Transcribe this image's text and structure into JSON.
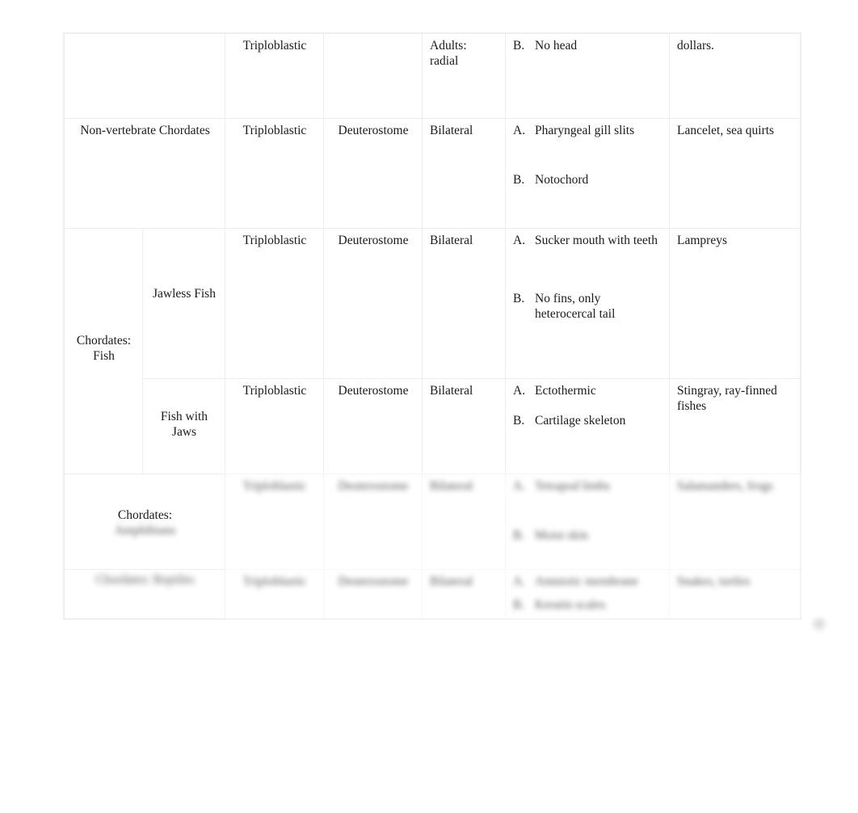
{
  "document": {
    "kind": "comparison-table",
    "columns": [
      "Group",
      "Subgroup",
      "Germ Layers",
      "Embryonic Development",
      "Symmetry",
      "Characteristics",
      "Examples"
    ]
  },
  "table": {
    "rows": [
      {
        "id": "row-echinoderms-partial",
        "group": "",
        "subgroup": "",
        "germ_layers": "Triploblastic",
        "development": "",
        "symmetry": "Adults:\nradial",
        "characteristics": [
          {
            "marker": "B.",
            "text": "No head"
          }
        ],
        "examples": "dollars."
      },
      {
        "id": "row-non-vertebrate-chordates",
        "group": "Non-vertebrate Chordates",
        "subgroup": "",
        "germ_layers": "Triploblastic",
        "development": "Deuterostome",
        "symmetry": "Bilateral",
        "characteristics": [
          {
            "marker": "A.",
            "text": "Pharyngeal gill slits"
          },
          {
            "marker": "B.",
            "text": "Notochord"
          }
        ],
        "examples": "Lancelet, sea quirts"
      },
      {
        "id": "row-jawless-fish",
        "group": "Chordates:\nFish",
        "subgroup": "Jawless Fish",
        "germ_layers": "Triploblastic",
        "development": "Deuterostome",
        "symmetry": "Bilateral",
        "characteristics": [
          {
            "marker": "A.",
            "text": "Sucker mouth with teeth"
          },
          {
            "marker": "B.",
            "text": "No fins, only heterocercal tail"
          }
        ],
        "examples": "Lampreys"
      },
      {
        "id": "row-fish-with-jaws",
        "group": "",
        "subgroup": "Fish with Jaws",
        "germ_layers": "Triploblastic",
        "development": "Deuterostome",
        "symmetry": "Bilateral",
        "characteristics": [
          {
            "marker": "A.",
            "text": "Ectothermic"
          },
          {
            "marker": "B.",
            "text": "Cartilage skeleton"
          }
        ],
        "examples": "Stingray, ray-finned fishes"
      },
      {
        "id": "row-chordates-blurred-1",
        "group_visible": "Chordates:",
        "group_blurred": "Amphibians",
        "subgroup": "",
        "germ_layers": "Triploblastic",
        "development": "Deuterostome",
        "symmetry": "Bilateral",
        "characteristics": [
          {
            "marker": "A.",
            "text": "Tetrapod limbs"
          },
          {
            "marker": "B.",
            "text": "Moist skin"
          }
        ],
        "examples": "Salamanders, frogs",
        "obscured": true
      },
      {
        "id": "row-chordates-blurred-2",
        "group_blurred": "Chordates: Reptiles",
        "subgroup": "",
        "germ_layers": "Triploblastic",
        "development": "Deuterostome",
        "symmetry": "Bilateral",
        "characteristics": [
          {
            "marker": "A.",
            "text": "Amniotic membrane"
          },
          {
            "marker": "B.",
            "text": "Keratin scales"
          }
        ],
        "examples": "Snakes, turtles",
        "obscured": true
      }
    ]
  },
  "labels": {
    "triploblastic": "Triploblastic",
    "deuterostome": "Deuterostome",
    "bilateral": "Bilateral",
    "adults_radial_line1": "Adults:",
    "adults_radial_line2": "radial",
    "no_head": "No head",
    "marker_a": "A.",
    "marker_b": "B.",
    "dollars": "dollars.",
    "non_vertebrate_chordates": "Non-vertebrate Chordates",
    "pharyngeal_gill_slits": "Pharyngeal gill slits",
    "notochord": "Notochord",
    "lancelet_sea_quirts": "Lancelet, sea quirts",
    "chordates_line1": "Chordates:",
    "chordates_fish_line2": "Fish",
    "jawless_fish": "Jawless Fish",
    "sucker_mouth_with_teeth": "Sucker mouth with teeth",
    "no_fins_heterocercal": "No fins, only heterocercal tail",
    "lampreys": "Lampreys",
    "fish_with_jaws_line1": "Fish with",
    "fish_with_jaws_line2": "Jaws",
    "ectothermic": "Ectothermic",
    "cartilage_skeleton": "Cartilage skeleton",
    "stingray_ray_finned": "Stingray, ray-finned fishes"
  },
  "colors": {
    "page_background": "#ffffff",
    "text": "#1a1a1a",
    "border": "#eceded"
  }
}
